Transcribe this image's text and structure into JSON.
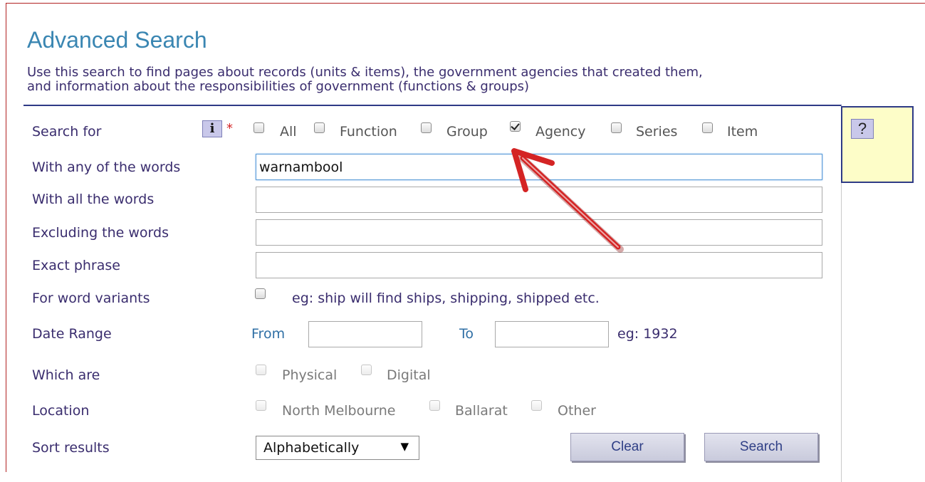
{
  "page": {
    "title": "Advanced Search",
    "description_line1": "Use this search to find pages about records (units & items), the government agencies that created them,",
    "description_line2": "and information about the responsibilities of government (functions & groups)"
  },
  "help": {
    "button_label": "?",
    "info_label": "i",
    "required_mark": "*"
  },
  "search_for": {
    "label": "Search for",
    "options": [
      {
        "label": "All",
        "checked": false
      },
      {
        "label": "Function",
        "checked": false
      },
      {
        "label": "Group",
        "checked": false
      },
      {
        "label": "Agency",
        "checked": true
      },
      {
        "label": "Series",
        "checked": false
      },
      {
        "label": "Item",
        "checked": false
      }
    ]
  },
  "fields": {
    "any_words": {
      "label": "With any of the words",
      "value": "warnambool"
    },
    "all_words": {
      "label": "With all the words",
      "value": ""
    },
    "excluding": {
      "label": "Excluding the words",
      "value": ""
    },
    "exact": {
      "label": "Exact phrase",
      "value": ""
    }
  },
  "variants": {
    "label": "For word variants",
    "hint": "eg: ship will find ships, shipping, shipped etc.",
    "checked": false
  },
  "date_range": {
    "label": "Date Range",
    "from_label": "From",
    "to_label": "To",
    "hint": "eg: 1932",
    "from_value": "",
    "to_value": ""
  },
  "which_are": {
    "label": "Which are",
    "options": [
      "Physical",
      "Digital"
    ]
  },
  "location": {
    "label": "Location",
    "options": [
      "North Melbourne",
      "Ballarat",
      "Other"
    ]
  },
  "sort": {
    "label": "Sort results",
    "selected": "Alphabetically"
  },
  "actions": {
    "clear": "Clear",
    "search": "Search"
  },
  "colors": {
    "accent": "#3a86b2",
    "label_text": "#3a2d6e",
    "annotation_arrow": "#d42424"
  }
}
